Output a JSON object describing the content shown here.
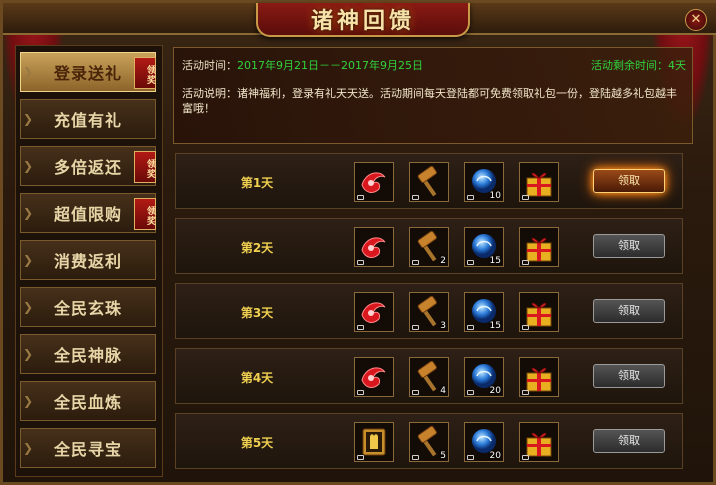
{
  "window": {
    "title": "诸神回馈",
    "close_symbol": "✕"
  },
  "sidebar": {
    "items": [
      {
        "label": "登录送礼",
        "badge": "领奖",
        "active": true
      },
      {
        "label": "充值有礼",
        "badge": "",
        "active": false
      },
      {
        "label": "多倍返还",
        "badge": "领奖",
        "active": false
      },
      {
        "label": "超值限购",
        "badge": "领奖",
        "active": false
      },
      {
        "label": "消费返利",
        "badge": "",
        "active": false
      },
      {
        "label": "全民玄珠",
        "badge": "",
        "active": false
      },
      {
        "label": "全民神脉",
        "badge": "",
        "active": false
      },
      {
        "label": "全民血炼",
        "badge": "",
        "active": false
      },
      {
        "label": "全民寻宝",
        "badge": "",
        "active": false
      }
    ]
  },
  "info": {
    "time_label": "活动时间：",
    "time_range": "2017年9月21日－－2017年9月25日",
    "remaining": "活动剩余时间：4天",
    "description": "活动说明：诸神福利，登录有礼天天送。活动期间每天登陆都可免费领取礼包一份，登陆越多礼包越丰富哦！"
  },
  "rows": [
    {
      "day": "第1天",
      "button": "领取",
      "highlight": true,
      "items": [
        {
          "icon": "red-gem-icon",
          "count": ""
        },
        {
          "icon": "hammer-icon",
          "count": ""
        },
        {
          "icon": "blue-orb-icon",
          "count": "10"
        },
        {
          "icon": "gift-box-icon",
          "count": ""
        }
      ]
    },
    {
      "day": "第2天",
      "button": "领取",
      "highlight": false,
      "items": [
        {
          "icon": "red-gem-icon",
          "count": ""
        },
        {
          "icon": "hammer-icon",
          "count": "2"
        },
        {
          "icon": "blue-orb-icon",
          "count": "15"
        },
        {
          "icon": "gift-box-icon",
          "count": ""
        }
      ]
    },
    {
      "day": "第3天",
      "button": "领取",
      "highlight": false,
      "items": [
        {
          "icon": "red-gem-icon",
          "count": ""
        },
        {
          "icon": "hammer-icon",
          "count": "3"
        },
        {
          "icon": "blue-orb-icon",
          "count": "15"
        },
        {
          "icon": "gift-box-icon",
          "count": ""
        }
      ]
    },
    {
      "day": "第4天",
      "button": "领取",
      "highlight": false,
      "items": [
        {
          "icon": "red-gem-icon",
          "count": ""
        },
        {
          "icon": "hammer-icon",
          "count": "4"
        },
        {
          "icon": "blue-orb-icon",
          "count": "20"
        },
        {
          "icon": "gift-box-icon",
          "count": ""
        }
      ]
    },
    {
      "day": "第5天",
      "button": "领取",
      "highlight": false,
      "items": [
        {
          "icon": "gold-book-icon",
          "count": ""
        },
        {
          "icon": "hammer-icon",
          "count": "5"
        },
        {
          "icon": "blue-orb-icon",
          "count": "20"
        },
        {
          "icon": "gift-box-icon",
          "count": ""
        }
      ]
    }
  ],
  "colors": {
    "accent_gold": "#f0d050",
    "green_text": "#30d23c",
    "title_red": "#8a1a14"
  }
}
